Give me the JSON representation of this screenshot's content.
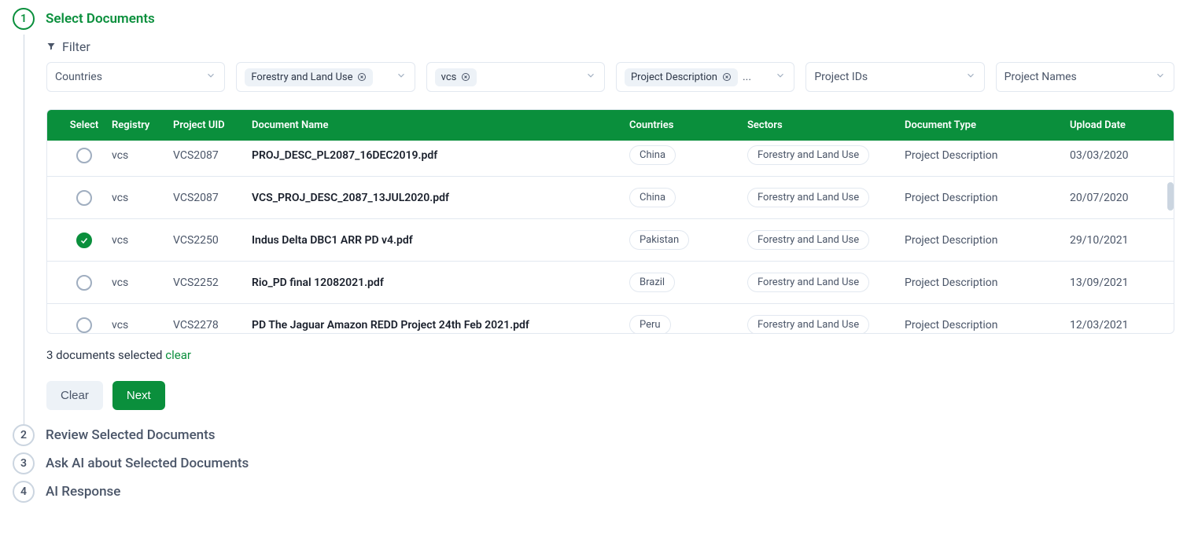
{
  "steps": {
    "s1": {
      "num": "1",
      "title": "Select Documents"
    },
    "s2": {
      "num": "2",
      "title": "Review Selected Documents"
    },
    "s3": {
      "num": "3",
      "title": "Ask AI about Selected Documents"
    },
    "s4": {
      "num": "4",
      "title": "AI Response"
    }
  },
  "filter": {
    "label": "Filter",
    "selects": {
      "countries_ph": "Countries",
      "sector_chip": "Forestry and Land Use",
      "registry_chip": "vcs",
      "doctype_chip": "Project Description",
      "doctype_more": "...",
      "pids_ph": "Project IDs",
      "pnames_ph": "Project Names"
    }
  },
  "table": {
    "headers": {
      "select": "Select",
      "registry": "Registry",
      "uid": "Project UID",
      "docname": "Document Name",
      "countries": "Countries",
      "sectors": "Sectors",
      "doctype": "Document Type",
      "upload": "Upload Date"
    },
    "rows": [
      {
        "selected": false,
        "registry": "vcs",
        "uid": "VCS2087",
        "docname": "PROJ_DESC_PL2087_16DEC2019.pdf",
        "country": "China",
        "sector": "Forestry and Land Use",
        "doctype": "Project Description",
        "upload": "03/03/2020"
      },
      {
        "selected": false,
        "registry": "vcs",
        "uid": "VCS2087",
        "docname": "VCS_PROJ_DESC_2087_13JUL2020.pdf",
        "country": "China",
        "sector": "Forestry and Land Use",
        "doctype": "Project Description",
        "upload": "20/07/2020"
      },
      {
        "selected": true,
        "registry": "vcs",
        "uid": "VCS2250",
        "docname": "Indus Delta DBC1 ARR PD v4.pdf",
        "country": "Pakistan",
        "sector": "Forestry and Land Use",
        "doctype": "Project Description",
        "upload": "29/10/2021"
      },
      {
        "selected": false,
        "registry": "vcs",
        "uid": "VCS2252",
        "docname": "Rio_PD final 12082021.pdf",
        "country": "Brazil",
        "sector": "Forestry and Land Use",
        "doctype": "Project Description",
        "upload": "13/09/2021"
      },
      {
        "selected": false,
        "registry": "vcs",
        "uid": "VCS2278",
        "docname": "PD The Jaguar Amazon REDD Project 24th Feb 2021.pdf",
        "country": "Peru",
        "sector": "Forestry and Land Use",
        "doctype": "Project Description",
        "upload": "12/03/2021"
      }
    ]
  },
  "selection": {
    "count_text": "3 documents selected ",
    "clear_link": "clear"
  },
  "buttons": {
    "clear": "Clear",
    "next": "Next"
  }
}
